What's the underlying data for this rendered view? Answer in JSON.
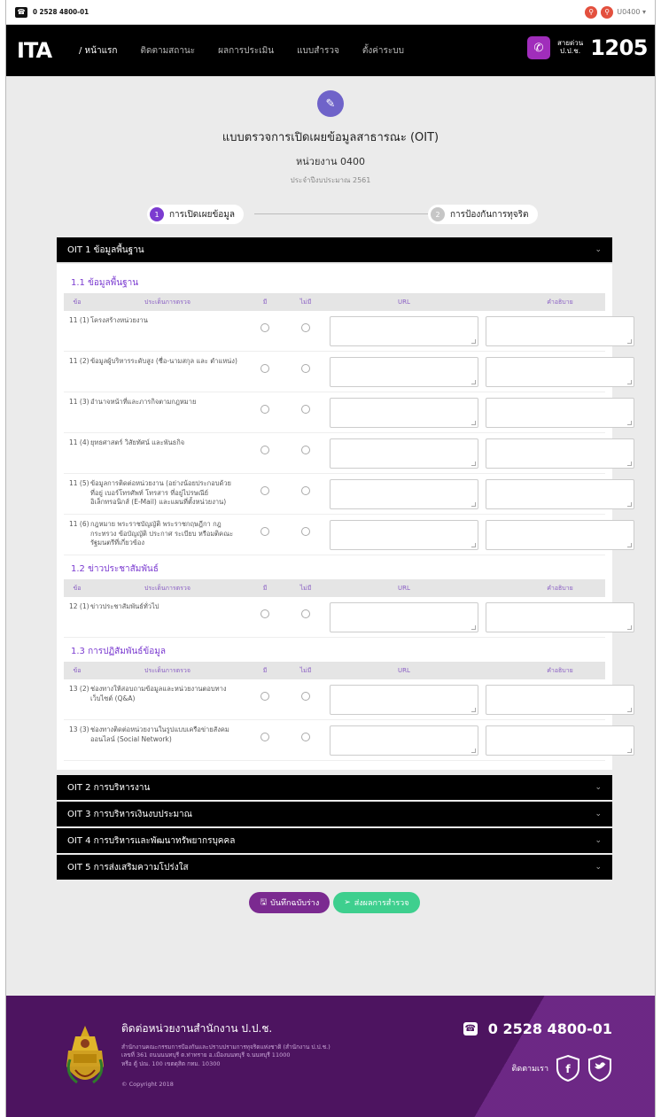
{
  "topbar": {
    "phone": "0 2528 4800-01",
    "user": "U0400 ▾"
  },
  "nav": {
    "brand": "ITA",
    "items": [
      "/ หน้าแรก",
      "ติดตามสถานะ",
      "ผลการประเมิน",
      "แบบสำรวจ",
      "ตั้งค่าระบบ"
    ],
    "hotline_label_1": "สายด่วน",
    "hotline_label_2": "ป.ป.ช.",
    "hotline_number": "1205"
  },
  "header": {
    "title": "แบบตรวจการเปิดเผยข้อมูลสาธารณะ (OIT)",
    "unit": "หน่วยงาน 0400",
    "year": "ประจำปีงบประมาณ 2561"
  },
  "steps": [
    {
      "num": "1",
      "label": "การเปิดเผยข้อมูล"
    },
    {
      "num": "2",
      "label": "การป้องกันการทุจริต"
    }
  ],
  "table_headers": {
    "no": "ข้อ",
    "item": "ประเด็นการตรวจ",
    "yes": "มี",
    "no_have": "ไม่มี",
    "url": "URL",
    "note": "คำอธิบาย"
  },
  "oit1": {
    "title": "OIT 1 ข้อมูลพื้นฐาน",
    "sections": [
      {
        "title": "1.1 ข้อมูลพื้นฐาน",
        "rows": [
          {
            "code": "11 (1)",
            "desc": "โครงสร้างหน่วยงาน"
          },
          {
            "code": "11 (2)",
            "desc": "ข้อมูลผู้บริหารระดับสูง (ชื่อ-นามสกุล และ ตำแหน่ง)"
          },
          {
            "code": "11 (3)",
            "desc": "อำนาจหน้าที่และภารกิจตามกฎหมาย"
          },
          {
            "code": "11 (4)",
            "desc": "ยุทธศาสตร์ วิสัยทัศน์ และพันธกิจ"
          },
          {
            "code": "11 (5)",
            "desc": "ข้อมูลการติดต่อหน่วยงาน (อย่างน้อยประกอบด้วย ที่อยู่ เบอร์โทรศัพท์ โทรสาร ที่อยู่ไปรษณีย์อิเล็กทรอนิกส์ (E-Mail) และแผนที่ตั้งหน่วยงาน)"
          },
          {
            "code": "11 (6)",
            "desc": "กฎหมาย พระราชบัญญัติ พระราชกฤษฎีกา กฎกระทรวง ข้อบัญญัติ ประกาศ ระเบียบ หรือมติคณะรัฐมนตรีที่เกี่ยวข้อง"
          }
        ]
      },
      {
        "title": "1.2 ข่าวประชาสัมพันธ์",
        "rows": [
          {
            "code": "12 (1)",
            "desc": "ข่าวประชาสัมพันธ์ทั่วไป"
          }
        ]
      },
      {
        "title": "1.3 การปฏิสัมพันธ์ข้อมูล",
        "rows": [
          {
            "code": "13 (2)",
            "desc": "ช่องทางให้สอบถามข้อมูลและหน่วยงานตอบทางเว็บไซต์ (Q&A)"
          },
          {
            "code": "13 (3)",
            "desc": "ช่องทางติดต่อหน่วยงานในรูปแบบเครือข่ายสังคมออนไลน์ (Social Network)"
          }
        ]
      }
    ]
  },
  "other_sections": [
    "OIT 2 การบริหารงาน",
    "OIT 3 การบริหารเงินงบประมาณ",
    "OIT 4 การบริหารและพัฒนาทรัพยากรบุคคล",
    "OIT 5 การส่งเสริมความโปร่งใส"
  ],
  "actions": {
    "draft": "บันทึกฉบับร่าง",
    "submit": "ส่งผลการสำรวจ"
  },
  "footer": {
    "title": "ติดต่อหน่วยงานสำนักงาน ป.ป.ช.",
    "address_1": "สำนักงานคณะกรรมการป้องกันและปราบปรามการทุจริตแห่งชาติ (สำนักงาน ป.ป.ช.)",
    "address_2": "เลขที่ 361 ถนนนนทบุรี ต.ท่าทราย อ.เมืองนนทบุรี จ.นนทบุรี 11000",
    "address_3": "หรือ ตู้ ปณ. 100 เขตดุสิต กทม. 10300",
    "copyright": "© Copyright 2018",
    "phone": "0 2528 4800-01",
    "follow": "ติดตามเรา"
  },
  "colors": {
    "accent": "#7b3bd0",
    "footer": "#4d1460",
    "draft": "#7b2a90",
    "submit": "#3ecf8e"
  }
}
